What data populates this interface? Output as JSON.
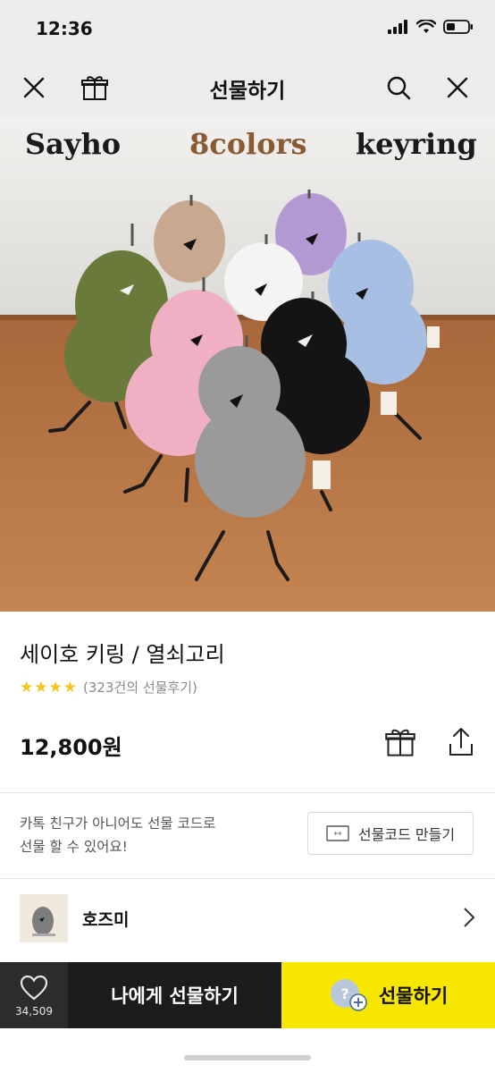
{
  "status_bar": {
    "time": "12:36"
  },
  "nav": {
    "title": "선물하기"
  },
  "hero": {
    "left_text": "Sayho",
    "center_text": "8colors",
    "right_text": "keyring"
  },
  "product": {
    "name": "세이호 키링 / 열쇠고리",
    "stars": "★★★★",
    "review_text": "(323건의 선물후기)",
    "price": "12,800원"
  },
  "gift_code": {
    "notice_line1": "카톡 친구가 아니어도 선물 코드로",
    "notice_line2": "선물 할 수 있어요!",
    "button_label": "선물코드 만들기"
  },
  "seller": {
    "name": "호즈미"
  },
  "bottom_bar": {
    "like_count": "34,509",
    "self_gift_label": "나에게 선물하기",
    "gift_label": "선물하기"
  },
  "colors": {
    "accent_yellow": "#f7e600",
    "star": "#f5c518",
    "dark_bar": "#1c1c1c"
  }
}
